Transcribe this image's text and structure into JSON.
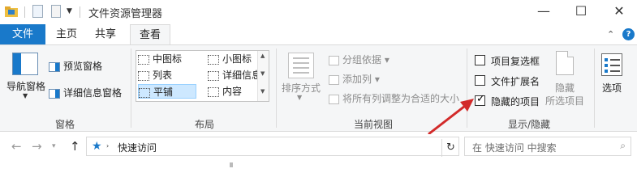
{
  "window": {
    "title": "文件资源管理器",
    "controls": {
      "minimize": "—",
      "maximize": "☐",
      "close": "✕"
    }
  },
  "tabs": [
    {
      "label": "文件",
      "active": false
    },
    {
      "label": "主页",
      "active": false
    },
    {
      "label": "共享",
      "active": false
    },
    {
      "label": "查看",
      "active": true
    }
  ],
  "ribbon": {
    "panes": {
      "nav_pane": "导航窗格",
      "preview_pane": "预览窗格",
      "details_pane": "详细信息窗格",
      "group_label": "窗格"
    },
    "layout": {
      "items": [
        "中图标",
        "小图标",
        "列表",
        "详细信息",
        "平铺",
        "内容"
      ],
      "selected": "平铺",
      "group_label": "布局"
    },
    "current_view": {
      "sort_by": "排序方式",
      "group_by": "分组依据",
      "add_columns": "添加列",
      "size_all_columns": "将所有列调整为合适的大小",
      "group_label": "当前视图"
    },
    "show_hide": {
      "checkboxes": [
        {
          "label": "项目复选框",
          "checked": false
        },
        {
          "label": "文件扩展名",
          "checked": false
        },
        {
          "label": "隐藏的项目",
          "checked": true
        }
      ],
      "hide_selected_line1": "隐藏",
      "hide_selected_line2": "所选项目",
      "group_label": "显示/隐藏"
    },
    "options": {
      "label": "选项"
    }
  },
  "address_bar": {
    "path": "快速访问",
    "search_placeholder": "在 快速访问 中搜索"
  },
  "colors": {
    "accent": "#1979ca",
    "ribbon_bg": "#f5f6f7",
    "annotation": "#d22a2a"
  }
}
